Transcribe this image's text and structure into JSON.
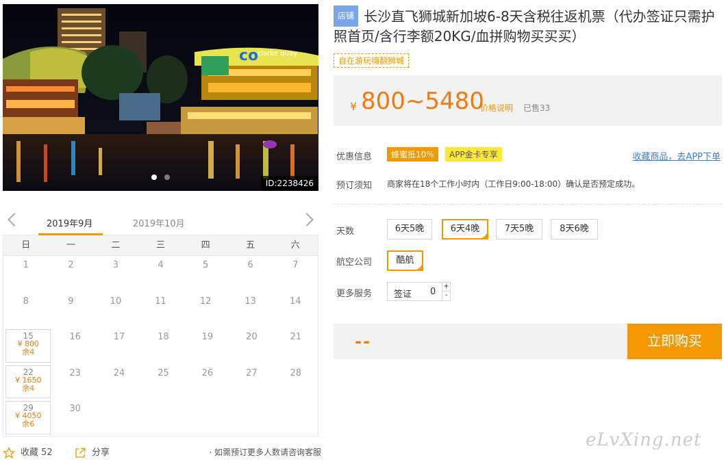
{
  "photo": {
    "id_label": "ID:2238426",
    "sign_text": "clarke quay",
    "dots": 2
  },
  "calendar": {
    "tabs": [
      "2019年9月",
      "2019年10月"
    ],
    "weekdays": [
      "日",
      "一",
      "二",
      "三",
      "四",
      "五",
      "六"
    ],
    "weeks": [
      [
        {
          "d": "1"
        },
        {
          "d": "2"
        },
        {
          "d": "3"
        },
        {
          "d": "4"
        },
        {
          "d": "5"
        },
        {
          "d": "6"
        },
        {
          "d": "7"
        }
      ],
      [
        {
          "d": "8"
        },
        {
          "d": "9"
        },
        {
          "d": "10"
        },
        {
          "d": "11"
        },
        {
          "d": "12"
        },
        {
          "d": "13"
        },
        {
          "d": "14"
        }
      ],
      [
        {
          "d": "15",
          "price": "¥ 800",
          "stock": "余4"
        },
        {
          "d": "16"
        },
        {
          "d": "17"
        },
        {
          "d": "18"
        },
        {
          "d": "19"
        },
        {
          "d": "20"
        },
        {
          "d": "21"
        }
      ],
      [
        {
          "d": "22",
          "price": "¥ 1650",
          "stock": "余4"
        },
        {
          "d": "23"
        },
        {
          "d": "24"
        },
        {
          "d": "25"
        },
        {
          "d": "26"
        },
        {
          "d": "27"
        },
        {
          "d": "28"
        }
      ],
      [
        {
          "d": "29",
          "price": "¥ 4050",
          "stock": "余6"
        },
        {
          "d": "30"
        },
        {
          "d": ""
        },
        {
          "d": ""
        },
        {
          "d": ""
        },
        {
          "d": ""
        },
        {
          "d": ""
        }
      ]
    ]
  },
  "share_bar": {
    "fav_label": "收藏 52",
    "share_label": "分享",
    "note": "· 如需预订更多人数请咨询客服"
  },
  "product": {
    "shop_badge": "店铺",
    "title": "长沙直飞狮城新加坡6-8天含税往返机票（代办签证只需护照首页/含行李额20KG/血拼购物买买买）",
    "tag": "自在游玩嗨翻狮城",
    "price_symbol": "¥",
    "price": "800~5480",
    "price_note": "价格说明",
    "sold": "已售33"
  },
  "info": {
    "promo_label": "优惠信息",
    "coupon_1": "蜂蜜抵10%",
    "coupon_2": "APP金卡专享",
    "fav_link": "收藏商品，去APP下单",
    "notice_label": "预订须知",
    "notice": "商家将在18个工作小时内（工作日9:00-18:00）确认是否预定成功。"
  },
  "options": {
    "days_label": "天数",
    "days": [
      "6天5晚",
      "6天4晚",
      "7天5晚",
      "8天6晚"
    ],
    "selected_day": "6天4晚",
    "airline_label": "航空公司",
    "airline": "酷航",
    "services_label": "更多服务",
    "service_name": "签证",
    "service_qty": "0",
    "plus": "+",
    "minus": "-"
  },
  "buy": {
    "total": "--",
    "button": "立即购买"
  },
  "watermark": "eLvXing.net",
  "colors": {
    "accent": "#f39800",
    "price": "#f37a0a",
    "link": "#3d7dd8",
    "shop_badge": "#7aa5e8"
  }
}
